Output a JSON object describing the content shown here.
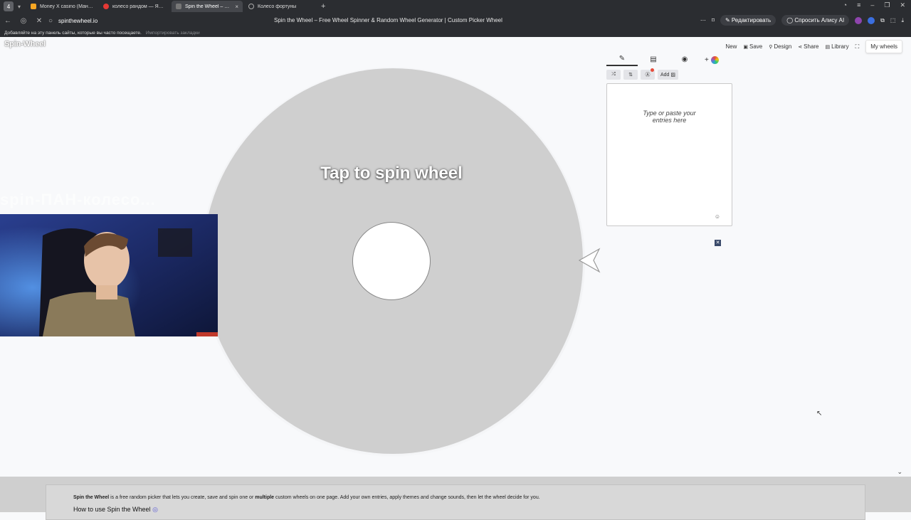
{
  "browser": {
    "tab_count": "4",
    "tabs": [
      {
        "title": "Money X casino (Мани Ис",
        "color": "#f5a623"
      },
      {
        "title": "колесо рандом — Яндекс",
        "color": "#e53935"
      },
      {
        "title": "Spin the Wheel – Free W",
        "color": "#777777",
        "active": true
      },
      {
        "title": "Колесо фортуны",
        "color": "#888888"
      }
    ],
    "url": "spinthewheel.io",
    "page_title": "Spin the Wheel – Free Wheel Spinner & Random Wheel Generator | Custom Picker Wheel",
    "edit_label": "Редактировать",
    "alice_label": "Спросить Алису AI",
    "bookmarks_hint": "Добавляйте на эту панель сайты, которые вы часто посещаете.",
    "bookmarks_import": "Импортировать закладки"
  },
  "site": {
    "logo": "Spin-Wheel",
    "nav": {
      "new": "New",
      "save": "Save",
      "design": "Design",
      "share": "Share",
      "library": "Library",
      "my_wheels": "My wheels"
    },
    "wheel": {
      "label": "Tap to spin wheel",
      "color": "#cfcfcf"
    },
    "ghost_text": "spin-ПАН-колесо...",
    "editor": {
      "add_label": "Add",
      "entries_placeholder": "Type or paste your entries here"
    },
    "below": {
      "intro_bold": "Spin the Wheel",
      "intro_rest_1": " is a free random picker that lets you create, save and spin one or ",
      "intro_bold_2": "multiple",
      "intro_rest_2": " custom wheels on one page. Add your own entries, apply themes and change sounds, then let the wheel decide for you.",
      "heading": "How to use Spin the Wheel"
    }
  }
}
